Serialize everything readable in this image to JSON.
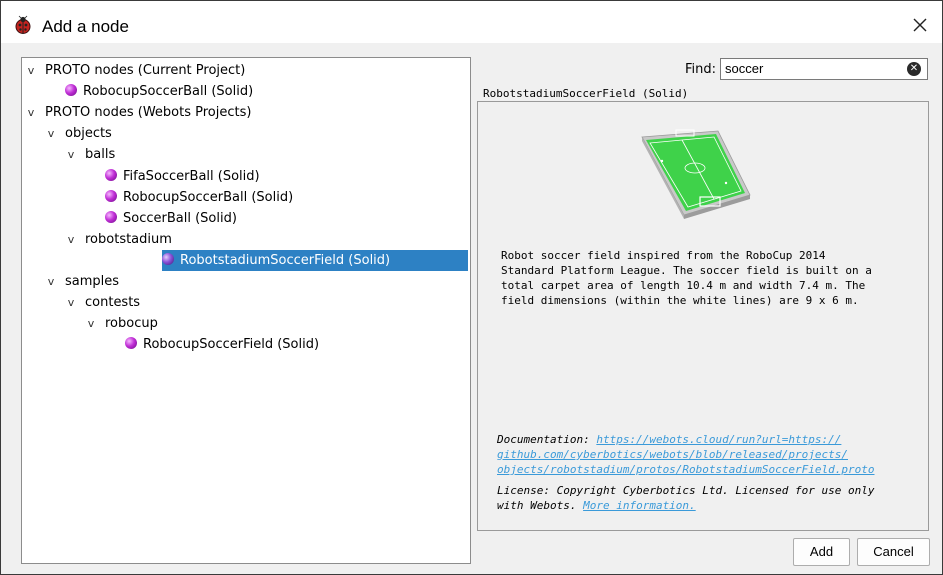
{
  "window": {
    "title": "Add a node"
  },
  "tree": {
    "items": [
      {
        "label": "PROTO nodes (Current Project)",
        "level": 0,
        "expander": "v",
        "icon": "none"
      },
      {
        "label": "RobocupSoccerBall (Solid)",
        "level": 1,
        "expander": "",
        "icon": "purple-sphere-icon"
      },
      {
        "label": "PROTO nodes (Webots Projects)",
        "level": 0,
        "expander": "v",
        "icon": "none"
      },
      {
        "label": "objects",
        "level": 1,
        "expander": "v",
        "icon": "none"
      },
      {
        "label": "balls",
        "level": 2,
        "expander": "v",
        "icon": "none"
      },
      {
        "label": "FifaSoccerBall (Solid)",
        "level": 3,
        "expander": "",
        "icon": "purple-sphere-icon"
      },
      {
        "label": "RobocupSoccerBall (Solid)",
        "level": 3,
        "expander": "",
        "icon": "purple-sphere-icon"
      },
      {
        "label": "SoccerBall (Solid)",
        "level": 3,
        "expander": "",
        "icon": "purple-sphere-icon"
      },
      {
        "label": "robotstadium",
        "level": 2,
        "expander": "v",
        "icon": "none"
      },
      {
        "label": "RobotstadiumSoccerField (Solid)",
        "level": 3,
        "expander": "",
        "icon": "purple-sphere-icon",
        "selected": true
      },
      {
        "label": "samples",
        "level": 1,
        "expander": "v",
        "icon": "none"
      },
      {
        "label": "contests",
        "level": 2,
        "expander": "v",
        "icon": "none"
      },
      {
        "label": "robocup",
        "level": 3,
        "expander": "v",
        "icon": "none"
      },
      {
        "label": "RobocupSoccerField (Solid)",
        "level": 4,
        "expander": "",
        "icon": "purple-sphere-icon"
      }
    ]
  },
  "find": {
    "label": "Find:",
    "value": "soccer"
  },
  "info": {
    "header": "RobotstadiumSoccerField (Solid)",
    "description": "Robot soccer field inspired from the RoboCup 2014\nStandard Platform League. The soccer field is built on a\ntotal carpet area of length 10.4 m and width 7.4 m. The\nfield dimensions (within the white lines) are 9 x 6 m.",
    "doc_label": "Documentation: ",
    "doc_link_line1": "https://webots.cloud/run?url=https://",
    "doc_link_line2": "github.com/cyberbotics/webots/blob/released/projects/",
    "doc_link_line3": "objects/robotstadium/protos/RobotstadiumSoccerField.proto",
    "license_line1": "License: Copyright Cyberbotics Ltd. Licensed for use only",
    "license_line2": "with Webots. ",
    "license_link": "More information."
  },
  "buttons": {
    "add": "Add",
    "cancel": "Cancel"
  },
  "colors": {
    "selection": "#2d81c4",
    "link": "#3a9ad9",
    "field_green": "#3fd24a"
  }
}
